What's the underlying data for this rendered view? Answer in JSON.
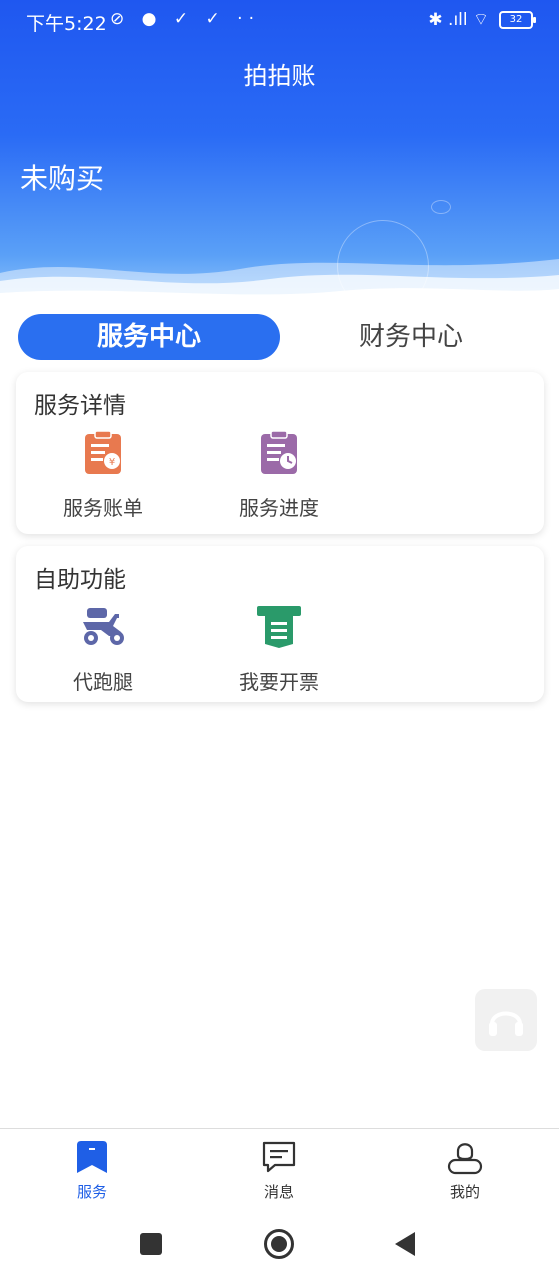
{
  "status_bar": {
    "time": "下午5:22",
    "left_icons": "⊘ ● ✓ ✓ ··",
    "right_icons": "✱ .ıll ⌔",
    "battery": "32"
  },
  "header": {
    "app_title": "拍拍账",
    "purchase_status": "未购买"
  },
  "tabs": [
    {
      "label": "服务中心",
      "active": true
    },
    {
      "label": "财务中心",
      "active": false
    }
  ],
  "sections": [
    {
      "title": "服务详情",
      "items": [
        {
          "label": "服务账单",
          "icon": "bill-icon",
          "color": "#e8794f"
        },
        {
          "label": "服务进度",
          "icon": "progress-icon",
          "color": "#9b6aa8"
        }
      ]
    },
    {
      "title": "自助功能",
      "items": [
        {
          "label": "代跑腿",
          "icon": "scooter-icon",
          "color": "#5d67a8"
        },
        {
          "label": "我要开票",
          "icon": "invoice-icon",
          "color": "#2a9a6a"
        }
      ]
    }
  ],
  "bottom_nav": [
    {
      "label": "服务",
      "icon": "service-icon",
      "active": true
    },
    {
      "label": "消息",
      "icon": "message-icon",
      "active": false
    },
    {
      "label": "我的",
      "icon": "profile-icon",
      "active": false
    }
  ],
  "colors": {
    "accent": "#2a6ff0",
    "active_nav": "#1f5fe6"
  }
}
